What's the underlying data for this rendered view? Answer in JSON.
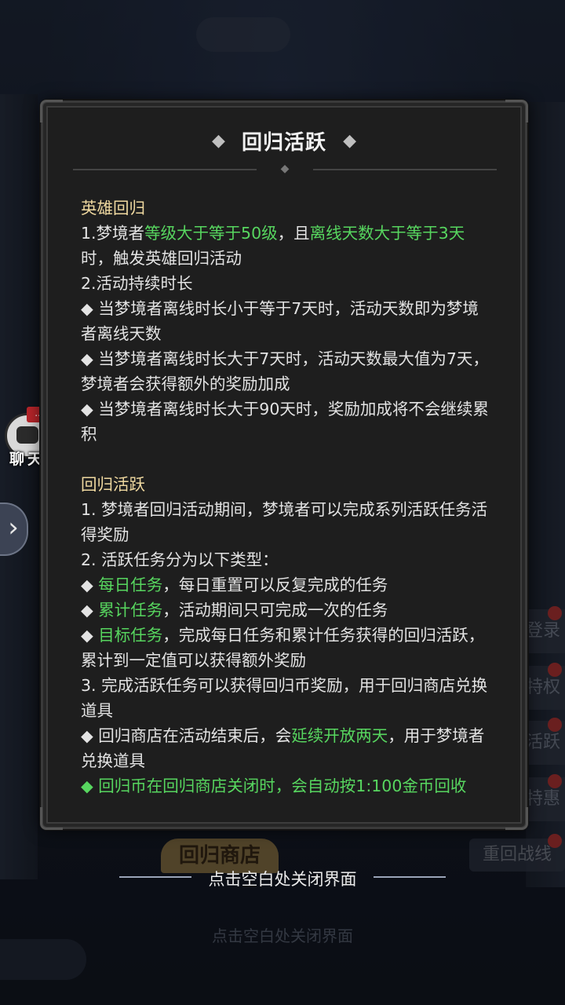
{
  "background": {
    "side_tabs": [
      "登录",
      "特权",
      "活跃",
      "特惠"
    ],
    "bottom_button": "回归商店",
    "right_button": "重回战线",
    "bottom_hint": "点击空白处关闭界面"
  },
  "chat": {
    "badge": "...",
    "label": "聊天"
  },
  "left_arrow": "›",
  "modal": {
    "title": "回归活跃",
    "paragraphs": [
      {
        "parts": [
          {
            "t": "英雄回归",
            "c": "h"
          }
        ]
      },
      {
        "parts": [
          {
            "t": "1.梦境者"
          },
          {
            "t": "等级大于等于50级",
            "c": "g"
          },
          {
            "t": "，且"
          },
          {
            "t": "离线天数大于等于3天",
            "c": "g"
          },
          {
            "t": "时，触发英雄回归活动"
          }
        ]
      },
      {
        "parts": [
          {
            "t": "2.活动持续时长"
          }
        ]
      },
      {
        "parts": [
          {
            "t": "◆ 当梦境者离线时长小于等于7天时，活动天数即为梦境者离线天数"
          }
        ]
      },
      {
        "parts": [
          {
            "t": "◆ 当梦境者离线时长大于7天时，活动天数最大值为7天，梦境者会获得额外的奖励加成"
          }
        ]
      },
      {
        "parts": [
          {
            "t": "◆ 当梦境者离线时长大于90天时，奖励加成将不会继续累积"
          }
        ]
      },
      {
        "gap": true
      },
      {
        "parts": [
          {
            "t": "回归活跃",
            "c": "h"
          }
        ]
      },
      {
        "parts": [
          {
            "t": "1. 梦境者回归活动期间，梦境者可以完成系列活跃任务活得奖励"
          }
        ]
      },
      {
        "parts": [
          {
            "t": "2. 活跃任务分为以下类型："
          }
        ]
      },
      {
        "parts": [
          {
            "t": "◆ "
          },
          {
            "t": "每日任务",
            "c": "g"
          },
          {
            "t": "，每日重置可以反复完成的任务"
          }
        ]
      },
      {
        "parts": [
          {
            "t": "◆ "
          },
          {
            "t": "累计任务",
            "c": "g"
          },
          {
            "t": "，活动期间只可完成一次的任务"
          }
        ]
      },
      {
        "parts": [
          {
            "t": "◆ "
          },
          {
            "t": "目标任务",
            "c": "g"
          },
          {
            "t": "，完成每日任务和累计任务获得的回归活跃，累计到一定值可以获得额外奖励"
          }
        ]
      },
      {
        "parts": [
          {
            "t": "3. 完成活跃任务可以获得回归币奖励，用于回归商店兑换道具"
          }
        ]
      },
      {
        "parts": [
          {
            "t": "◆ 回归商店在活动结束后，会"
          },
          {
            "t": "延续开放两天",
            "c": "g"
          },
          {
            "t": "，用于梦境者兑换道具"
          }
        ]
      },
      {
        "parts": [
          {
            "t": "◆ 回归币在回归商店关闭时，会自动按1:100金币回收",
            "c": "g"
          }
        ]
      }
    ]
  },
  "close_hint": "点击空白处关闭界面",
  "colors": {
    "highlight_green": "#57d65f",
    "heading_gold": "#f0d9a0"
  }
}
